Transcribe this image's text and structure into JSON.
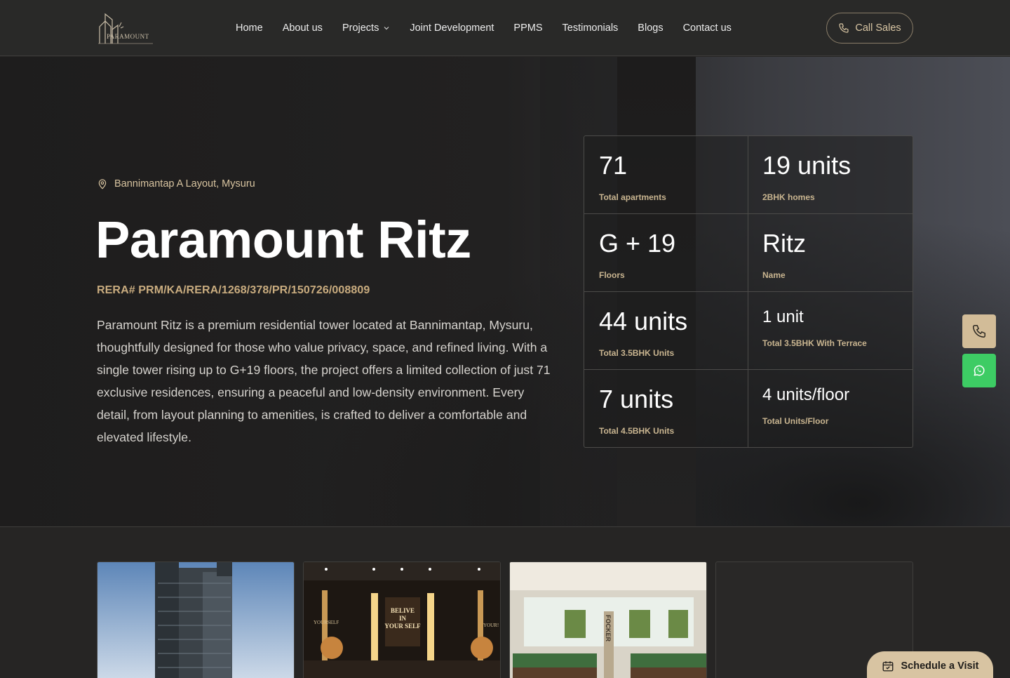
{
  "brand": {
    "logo_text": "PARAMOUNT"
  },
  "nav": {
    "items": [
      "Home",
      "About us",
      "Projects",
      "Joint Development",
      "PPMS",
      "Testimonials",
      "Blogs",
      "Contact us"
    ]
  },
  "header": {
    "call_label": "Call Sales"
  },
  "hero": {
    "location": "Bannimantap A Layout, Mysuru",
    "title": "Paramount Ritz",
    "rera": "RERA# PRM/KA/RERA/1268/378/PR/150726/008809",
    "description": "Paramount Ritz is a premium residential tower located at Bannimantap, Mysuru, thoughtfully designed for those who value privacy, space, and refined living. With a single tower rising up to G+19 floors, the project offers a limited collection of just 71 exclusive residences, ensuring a peaceful and low-density environment. Every detail, from layout planning to amenities, is crafted to deliver a comfortable and elevated lifestyle."
  },
  "stats": [
    {
      "value": "71",
      "label": "Total apartments"
    },
    {
      "value": "19 units",
      "label": "2BHK homes"
    },
    {
      "value": "G + 19",
      "label": "Floors"
    },
    {
      "value": "Ritz",
      "label": "Name"
    },
    {
      "value": "44 units",
      "label": "Total 3.5BHK Units"
    },
    {
      "value": "1 unit",
      "label": "Total 3.5BHK With Terrace"
    },
    {
      "value": "7 units",
      "label": "Total 4.5BHK Units"
    },
    {
      "value": "4 units/floor",
      "label": "Total Units/Floor"
    }
  ],
  "gym_signs": {
    "main": [
      "BELIVE",
      "IN",
      "YOUR SELF"
    ],
    "left": "YOURSELF",
    "right": "YOUR!"
  },
  "lounge_sign": "FOCKER",
  "cta": {
    "schedule_label": "Schedule a Visit"
  },
  "colors": {
    "accent": "#d8c4a2",
    "gold_text": "#c9ac7f",
    "whatsapp": "#3dcc64"
  }
}
